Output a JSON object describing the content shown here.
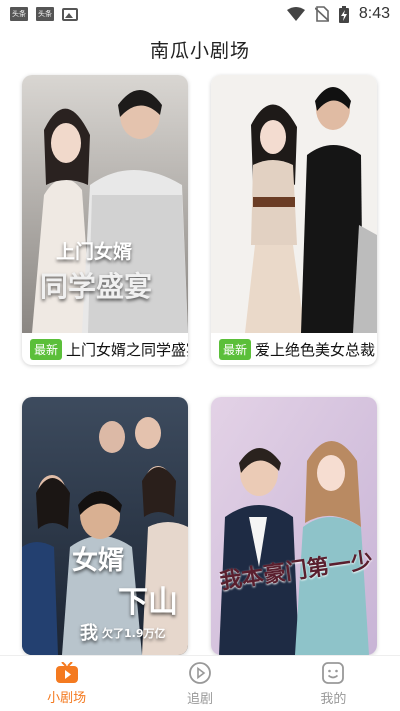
{
  "status_bar": {
    "notifications": [
      "头条",
      "头条"
    ],
    "time": "8:43"
  },
  "header": {
    "title": "南瓜小剧场"
  },
  "dramas": [
    {
      "badge": "最新",
      "title": "上门女婿之同学盛宴",
      "poster_text_1": "上门女婿",
      "poster_text_2": "同学盛宴"
    },
    {
      "badge": "最新",
      "title": "爱上绝色美女总裁"
    },
    {
      "poster_text_1": "女婿",
      "poster_text_2": "下山",
      "poster_text_3": "我",
      "poster_text_4": "欠了1.9万亿"
    },
    {
      "poster_text_1": "我本豪门第一少"
    }
  ],
  "tab_bar": {
    "tabs": [
      {
        "label": "小剧场",
        "icon": "play-tv-icon",
        "active": true
      },
      {
        "label": "追剧",
        "icon": "play-circle-icon",
        "active": false
      },
      {
        "label": "我的",
        "icon": "smiley-tv-icon",
        "active": false
      }
    ]
  },
  "colors": {
    "accent": "#f47a20",
    "badge": "#5bbf3a"
  }
}
